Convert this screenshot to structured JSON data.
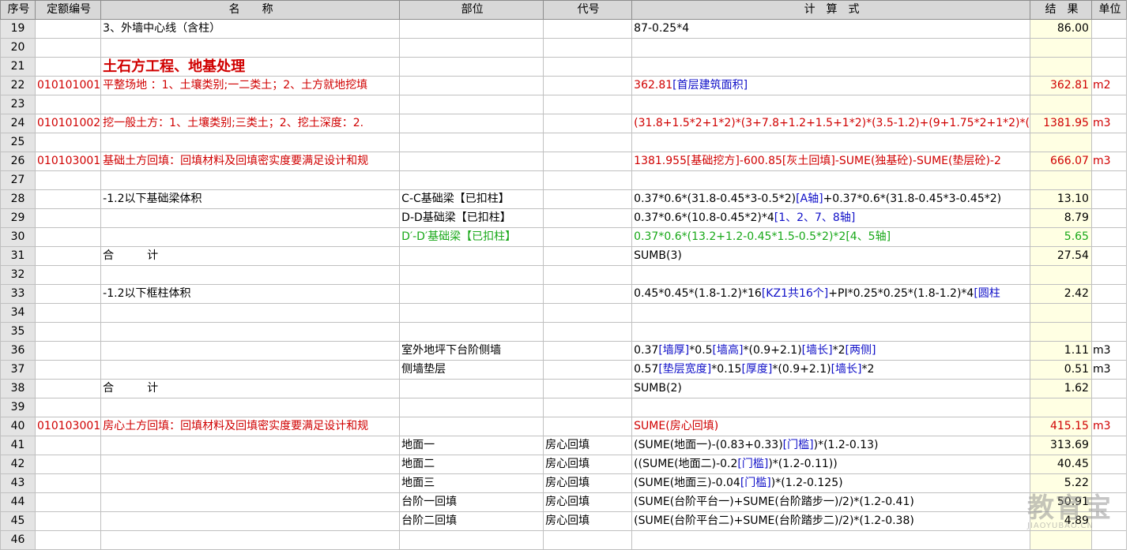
{
  "headers": {
    "seq": "序号",
    "code": "定额编号",
    "name": "名　　称",
    "part": "部位",
    "alias": "代号",
    "formula": "计　算　式",
    "result": "结　果",
    "unit": "单位"
  },
  "rows": [
    {
      "seq": "19",
      "code": "",
      "name": "3、外墙中心线（含柱）",
      "part": "",
      "alias": "",
      "formula": [
        {
          "t": "87-0.25*4"
        }
      ],
      "result": "86.00",
      "unit": ""
    },
    {
      "seq": "20",
      "code": "",
      "name": "",
      "part": "",
      "alias": "",
      "formula": [],
      "result": "",
      "unit": ""
    },
    {
      "seq": "21",
      "code": "",
      "name": "土石方工程、地基处理",
      "part": "",
      "alias": "",
      "formula": [],
      "result": "",
      "unit": "",
      "style": "section"
    },
    {
      "seq": "22",
      "code": "010101001",
      "name": "平整场地 ：1、土壤类别;一二类土；2、土方就地挖填",
      "part": "",
      "alias": "",
      "formula": [
        {
          "t": "362.81",
          "c": "red"
        },
        {
          "t": "[首层建筑面积]",
          "c": "blue"
        }
      ],
      "result": "362.81",
      "unit": "m2",
      "style": "red"
    },
    {
      "seq": "23",
      "code": "",
      "name": "",
      "part": "",
      "alias": "",
      "formula": [],
      "result": "",
      "unit": ""
    },
    {
      "seq": "24",
      "code": "010101002",
      "name": "挖一般土方：1、土壤类别;三类土；2、挖土深度：2.",
      "part": "",
      "alias": "",
      "formula": [
        {
          "t": "(31.8+1.5*2+1*2)*(3+7.8+1.2+1.5+1*2)*(3.5-1.2)+(9+1.75*2+1*2)*(",
          "c": "red"
        }
      ],
      "result": "1381.95",
      "unit": "m3",
      "style": "red"
    },
    {
      "seq": "25",
      "code": "",
      "name": "",
      "part": "",
      "alias": "",
      "formula": [],
      "result": "",
      "unit": ""
    },
    {
      "seq": "26",
      "code": "010103001",
      "name": "基础土方回填：回填材料及回填密实度要满足设计和规",
      "part": "",
      "alias": "",
      "formula": [
        {
          "t": "1381.955[基础挖方]-600.85[灰土回填]-SUME(独基砼)-SUME(垫层砼)-2",
          "c": "red"
        }
      ],
      "result": "666.07",
      "unit": "m3",
      "style": "red"
    },
    {
      "seq": "27",
      "code": "",
      "name": "",
      "part": "",
      "alias": "",
      "formula": [],
      "result": "",
      "unit": ""
    },
    {
      "seq": "28",
      "code": "",
      "name": "-1.2以下基础梁体积",
      "part": "C-C基础梁【已扣柱】",
      "alias": "",
      "formula": [
        {
          "t": "0.37*0.6*(31.8-0.45*3-0.5*2)"
        },
        {
          "t": "[A轴]",
          "c": "blue"
        },
        {
          "t": "+0.37*0.6*(31.8-0.45*3-0.45*2)"
        }
      ],
      "result": "13.10",
      "unit": ""
    },
    {
      "seq": "29",
      "code": "",
      "name": "",
      "part": "D-D基础梁【已扣柱】",
      "alias": "",
      "formula": [
        {
          "t": "0.37*0.6*(10.8-0.45*2)*4"
        },
        {
          "t": "[1、2、7、8轴]",
          "c": "blue"
        }
      ],
      "result": "8.79",
      "unit": ""
    },
    {
      "seq": "30",
      "code": "",
      "name": "",
      "part": "D′-D′基础梁【已扣柱】",
      "alias": "",
      "formula": [
        {
          "t": "0.37*0.6*(13.2+1.2-0.45*1.5-0.5*2)*2[4、5轴]",
          "c": "green"
        }
      ],
      "result": "5.65",
      "unit": "",
      "style": "green"
    },
    {
      "seq": "31",
      "code": "",
      "name": "合　　　计",
      "part": "",
      "alias": "",
      "formula": [
        {
          "t": "SUMB(3)"
        }
      ],
      "result": "27.54",
      "unit": ""
    },
    {
      "seq": "32",
      "code": "",
      "name": "",
      "part": "",
      "alias": "",
      "formula": [],
      "result": "",
      "unit": ""
    },
    {
      "seq": "33",
      "code": "",
      "name": "-1.2以下框柱体积",
      "part": "",
      "alias": "",
      "formula": [
        {
          "t": "0.45*0.45*(1.8-1.2)*16"
        },
        {
          "t": "[KZ1共16个]",
          "c": "blue"
        },
        {
          "t": "+PI*0.25*0.25*(1.8-1.2)*4"
        },
        {
          "t": "[圆柱",
          "c": "blue"
        }
      ],
      "result": "2.42",
      "unit": ""
    },
    {
      "seq": "34",
      "code": "",
      "name": "",
      "part": "",
      "alias": "",
      "formula": [],
      "result": "",
      "unit": ""
    },
    {
      "seq": "35",
      "code": "",
      "name": "",
      "part": "",
      "alias": "",
      "formula": [],
      "result": "",
      "unit": ""
    },
    {
      "seq": "36",
      "code": "",
      "name": "",
      "part": "室外地坪下台阶侧墙",
      "alias": "",
      "formula": [
        {
          "t": "0.37"
        },
        {
          "t": "[墙厚]",
          "c": "blue"
        },
        {
          "t": "*0.5"
        },
        {
          "t": "[墙高]",
          "c": "blue"
        },
        {
          "t": "*(0.9+2.1)"
        },
        {
          "t": "[墙长]",
          "c": "blue"
        },
        {
          "t": "*2"
        },
        {
          "t": "[两侧]",
          "c": "blue"
        }
      ],
      "result": "1.11",
      "unit": "m3"
    },
    {
      "seq": "37",
      "code": "",
      "name": "",
      "part": "侧墙垫层",
      "alias": "",
      "formula": [
        {
          "t": "0.57"
        },
        {
          "t": "[垫层宽度]",
          "c": "blue"
        },
        {
          "t": "*0.15"
        },
        {
          "t": "[厚度]",
          "c": "blue"
        },
        {
          "t": "*(0.9+2.1)"
        },
        {
          "t": "[墙长]",
          "c": "blue"
        },
        {
          "t": "*2"
        }
      ],
      "result": "0.51",
      "unit": "m3"
    },
    {
      "seq": "38",
      "code": "",
      "name": "合　　　计",
      "part": "",
      "alias": "",
      "formula": [
        {
          "t": "SUMB(2)"
        }
      ],
      "result": "1.62",
      "unit": ""
    },
    {
      "seq": "39",
      "code": "",
      "name": "",
      "part": "",
      "alias": "",
      "formula": [],
      "result": "",
      "unit": ""
    },
    {
      "seq": "40",
      "code": "010103001",
      "name": "房心土方回填：回填材料及回填密实度要满足设计和规",
      "part": "",
      "alias": "",
      "formula": [
        {
          "t": "SUME(房心回填)",
          "c": "red"
        }
      ],
      "result": "415.15",
      "unit": "m3",
      "style": "red"
    },
    {
      "seq": "41",
      "code": "",
      "name": "",
      "part": "地面一",
      "alias": "房心回填",
      "formula": [
        {
          "t": "(SUME(地面一)-(0.83+0.33)"
        },
        {
          "t": "[门槛]",
          "c": "blue"
        },
        {
          "t": ")*(1.2-0.13)"
        }
      ],
      "result": "313.69",
      "unit": ""
    },
    {
      "seq": "42",
      "code": "",
      "name": "",
      "part": "地面二",
      "alias": "房心回填",
      "formula": [
        {
          "t": "((SUME(地面二)-0.2"
        },
        {
          "t": "[门槛]",
          "c": "blue"
        },
        {
          "t": ")*(1.2-0.11))"
        }
      ],
      "result": "40.45",
      "unit": ""
    },
    {
      "seq": "43",
      "code": "",
      "name": "",
      "part": "地面三",
      "alias": "房心回填",
      "formula": [
        {
          "t": "(SUME(地面三)-0.04"
        },
        {
          "t": "[门槛]",
          "c": "blue"
        },
        {
          "t": ")*(1.2-0.125)"
        }
      ],
      "result": "5.22",
      "unit": ""
    },
    {
      "seq": "44",
      "code": "",
      "name": "",
      "part": "台阶一回填",
      "alias": "房心回填",
      "formula": [
        {
          "t": "(SUME(台阶平台一)+SUME(台阶踏步一)/2)*(1.2-0.41)"
        }
      ],
      "result": "50.91",
      "unit": ""
    },
    {
      "seq": "45",
      "code": "",
      "name": "",
      "part": "台阶二回填",
      "alias": "房心回填",
      "formula": [
        {
          "t": "(SUME(台阶平台二)+SUME(台阶踏步二)/2)*(1.2-0.38)"
        }
      ],
      "result": "4.89",
      "unit": ""
    },
    {
      "seq": "46",
      "code": "",
      "name": "",
      "part": "",
      "alias": "",
      "formula": [],
      "result": "",
      "unit": ""
    }
  ],
  "watermark": {
    "main": "教育宝",
    "sub": "JIAOYUBAO.CN"
  },
  "colors": {
    "red": "#d00000",
    "blue": "#1010c8",
    "green": "#18a818",
    "result_bg": "#ffffe3",
    "header_bg": "#d8d8d8"
  }
}
